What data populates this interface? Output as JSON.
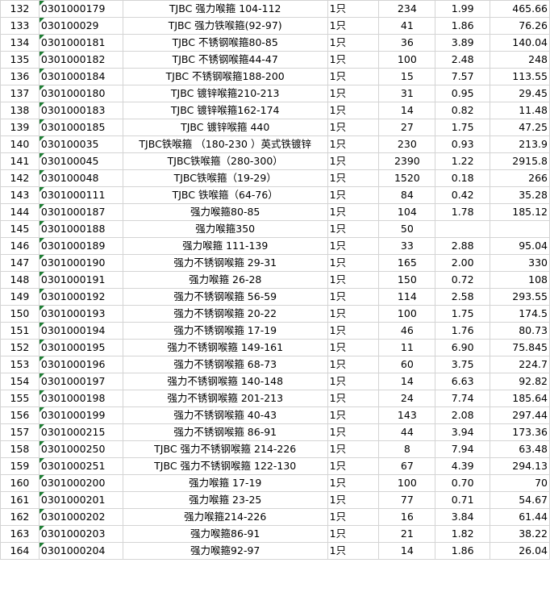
{
  "rows": [
    {
      "idx": "132",
      "code": "0301000179",
      "name": "TJBC 强力喉箍 104-112",
      "unit": "1只",
      "qty": "234",
      "price": "1.99",
      "amount": "465.66"
    },
    {
      "idx": "133",
      "code": "030100029",
      "name": "TJBC 强力铁喉箍(92-97)",
      "unit": "1只",
      "qty": "41",
      "price": "1.86",
      "amount": "76.26"
    },
    {
      "idx": "134",
      "code": "0301000181",
      "name": "TJBC 不锈钢喉箍80-85",
      "unit": "1只",
      "qty": "36",
      "price": "3.89",
      "amount": "140.04"
    },
    {
      "idx": "135",
      "code": "0301000182",
      "name": "TJBC 不锈钢喉箍44-47",
      "unit": "1只",
      "qty": "100",
      "price": "2.48",
      "amount": "248"
    },
    {
      "idx": "136",
      "code": "0301000184",
      "name": "TJBC 不锈钢喉箍188-200",
      "unit": "1只",
      "qty": "15",
      "price": "7.57",
      "amount": "113.55"
    },
    {
      "idx": "137",
      "code": "0301000180",
      "name": "TJBC 镀锌喉箍210-213",
      "unit": "1只",
      "qty": "31",
      "price": "0.95",
      "amount": "29.45"
    },
    {
      "idx": "138",
      "code": "0301000183",
      "name": "TJBC 镀锌喉箍162-174",
      "unit": "1只",
      "qty": "14",
      "price": "0.82",
      "amount": "11.48"
    },
    {
      "idx": "139",
      "code": "0301000185",
      "name": "TJBC 镀锌喉箍 440",
      "unit": "1只",
      "qty": "27",
      "price": "1.75",
      "amount": "47.25"
    },
    {
      "idx": "140",
      "code": "030100035",
      "name": "TJBC铁喉箍 （180-230 ）英式铁镀锌",
      "unit": "1只",
      "qty": "230",
      "price": "0.93",
      "amount": "213.9"
    },
    {
      "idx": "141",
      "code": "030100045",
      "name": "TJBC铁喉箍（280-300）",
      "unit": "1只",
      "qty": "2390",
      "price": "1.22",
      "amount": "2915.8"
    },
    {
      "idx": "142",
      "code": "030100048",
      "name": "TJBC铁喉箍（19-29）",
      "unit": "1只",
      "qty": "1520",
      "price": "0.18",
      "amount": "266"
    },
    {
      "idx": "143",
      "code": "0301000111",
      "name": "TJBC 铁喉箍（64-76）",
      "unit": "1只",
      "qty": "84",
      "price": "0.42",
      "amount": "35.28"
    },
    {
      "idx": "144",
      "code": "0301000187",
      "name": "强力喉箍80-85",
      "unit": "1只",
      "qty": "104",
      "price": "1.78",
      "amount": "185.12"
    },
    {
      "idx": "145",
      "code": "0301000188",
      "name": "强力喉箍350",
      "unit": "1只",
      "qty": "50",
      "price": "",
      "amount": ""
    },
    {
      "idx": "146",
      "code": "0301000189",
      "name": "强力喉箍 111-139",
      "unit": "1只",
      "qty": "33",
      "price": "2.88",
      "amount": "95.04"
    },
    {
      "idx": "147",
      "code": "0301000190",
      "name": "强力不锈钢喉箍 29-31",
      "unit": "1只",
      "qty": "165",
      "price": "2.00",
      "amount": "330"
    },
    {
      "idx": "148",
      "code": "0301000191",
      "name": "强力喉箍 26-28",
      "unit": "1只",
      "qty": "150",
      "price": "0.72",
      "amount": "108"
    },
    {
      "idx": "149",
      "code": "0301000192",
      "name": "强力不锈钢喉箍 56-59",
      "unit": "1只",
      "qty": "114",
      "price": "2.58",
      "amount": "293.55"
    },
    {
      "idx": "150",
      "code": "0301000193",
      "name": "强力不锈钢喉箍 20-22",
      "unit": "1只",
      "qty": "100",
      "price": "1.75",
      "amount": "174.5"
    },
    {
      "idx": "151",
      "code": "0301000194",
      "name": "强力不锈钢喉箍 17-19",
      "unit": "1只",
      "qty": "46",
      "price": "1.76",
      "amount": "80.73"
    },
    {
      "idx": "152",
      "code": "0301000195",
      "name": "强力不锈钢喉箍 149-161",
      "unit": "1只",
      "qty": "11",
      "price": "6.90",
      "amount": "75.845"
    },
    {
      "idx": "153",
      "code": "0301000196",
      "name": "强力不锈钢喉箍 68-73",
      "unit": "1只",
      "qty": "60",
      "price": "3.75",
      "amount": "224.7"
    },
    {
      "idx": "154",
      "code": "0301000197",
      "name": "强力不锈钢喉箍 140-148",
      "unit": "1只",
      "qty": "14",
      "price": "6.63",
      "amount": "92.82"
    },
    {
      "idx": "155",
      "code": "0301000198",
      "name": "强力不锈钢喉箍 201-213",
      "unit": "1只",
      "qty": "24",
      "price": "7.74",
      "amount": "185.64"
    },
    {
      "idx": "156",
      "code": "0301000199",
      "name": "强力不锈钢喉箍 40-43",
      "unit": "1只",
      "qty": "143",
      "price": "2.08",
      "amount": "297.44"
    },
    {
      "idx": "157",
      "code": "0301000215",
      "name": "强力不锈钢喉箍 86-91",
      "unit": "1只",
      "qty": "44",
      "price": "3.94",
      "amount": "173.36"
    },
    {
      "idx": "158",
      "code": "0301000250",
      "name": "TJBC 强力不锈钢喉箍 214-226",
      "unit": "1只",
      "qty": "8",
      "price": "7.94",
      "amount": "63.48"
    },
    {
      "idx": "159",
      "code": "0301000251",
      "name": "TJBC 强力不锈钢喉箍 122-130",
      "unit": "1只",
      "qty": "67",
      "price": "4.39",
      "amount": "294.13"
    },
    {
      "idx": "160",
      "code": "0301000200",
      "name": "强力喉箍 17-19",
      "unit": "1只",
      "qty": "100",
      "price": "0.70",
      "amount": "70"
    },
    {
      "idx": "161",
      "code": "0301000201",
      "name": "强力喉箍 23-25",
      "unit": "1只",
      "qty": "77",
      "price": "0.71",
      "amount": "54.67"
    },
    {
      "idx": "162",
      "code": "0301000202",
      "name": "强力喉箍214-226",
      "unit": "1只",
      "qty": "16",
      "price": "3.84",
      "amount": "61.44"
    },
    {
      "idx": "163",
      "code": "0301000203",
      "name": "强力喉箍86-91",
      "unit": "1只",
      "qty": "21",
      "price": "1.82",
      "amount": "38.22"
    },
    {
      "idx": "164",
      "code": "0301000204",
      "name": "强力喉箍92-97",
      "unit": "1只",
      "qty": "14",
      "price": "1.86",
      "amount": "26.04"
    }
  ],
  "colors": {
    "grid": "#d4d4d4",
    "indicator": "#1e7e34",
    "background": "#ffffff"
  }
}
